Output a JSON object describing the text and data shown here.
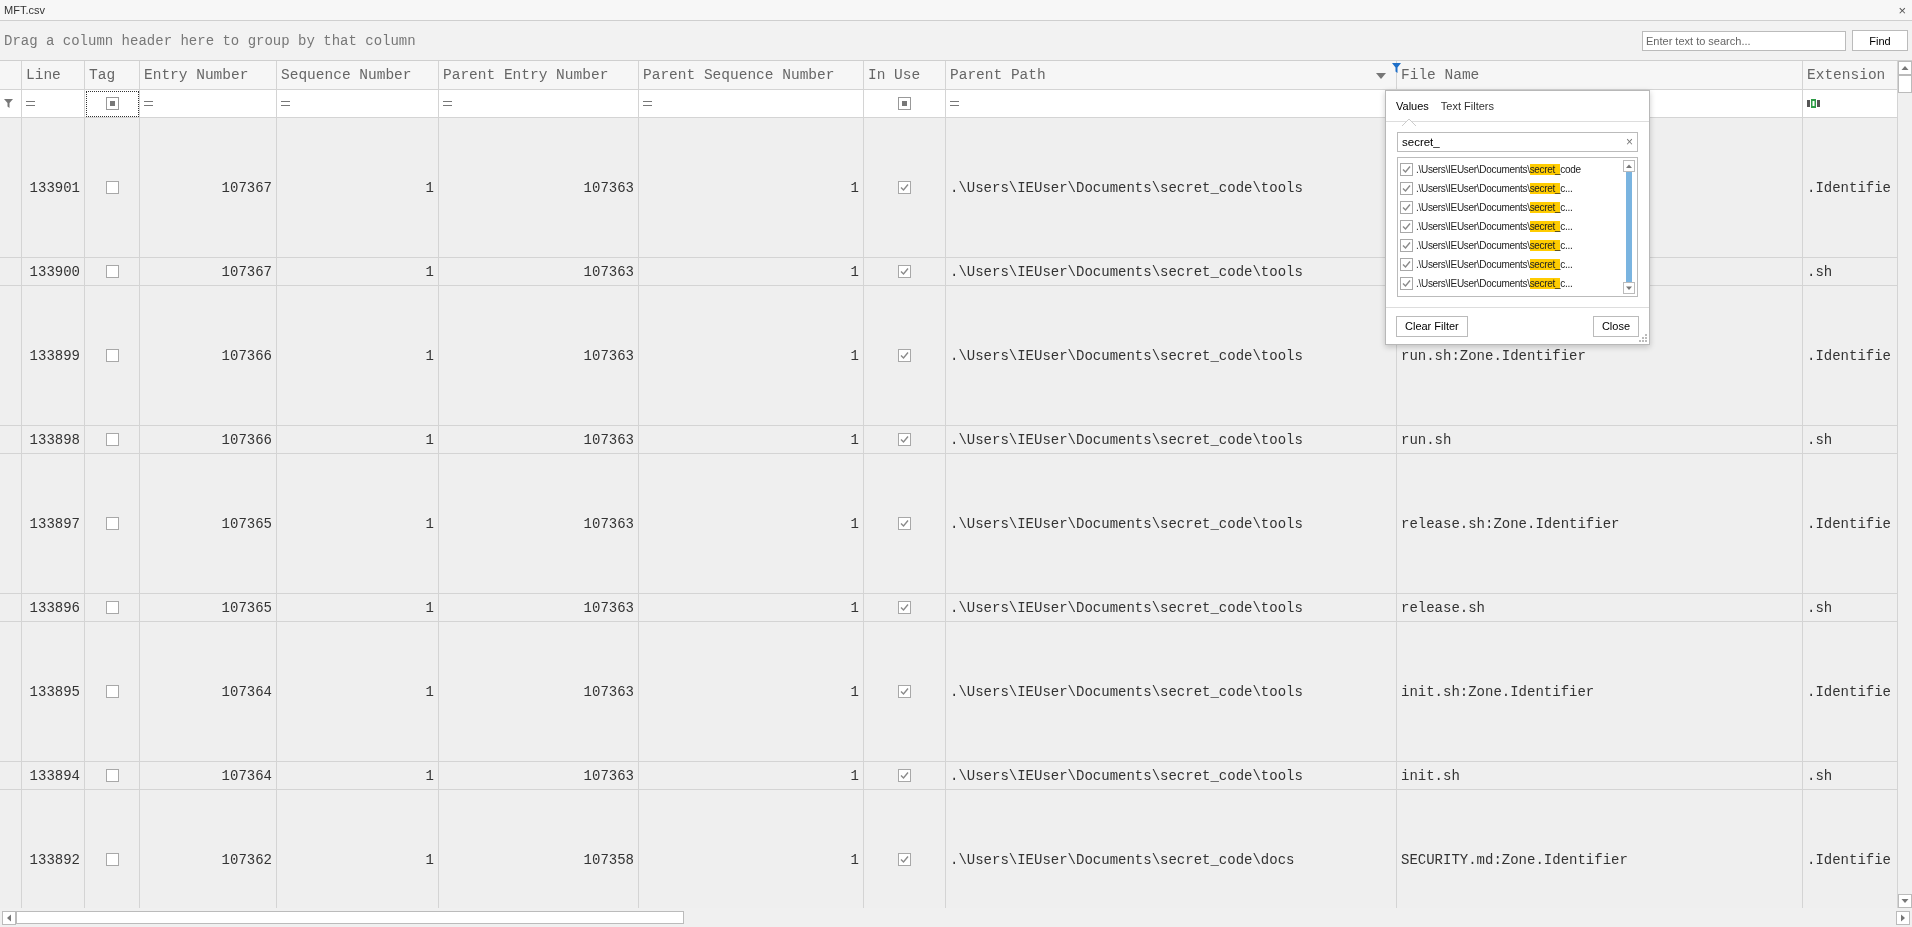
{
  "window": {
    "title": "MFT.csv",
    "close": "×"
  },
  "group_panel": {
    "hint": "Drag a column header here to group by that column"
  },
  "search": {
    "placeholder": "Enter text to search...",
    "button": "Find"
  },
  "columns": [
    {
      "label": "Line",
      "kind": "number",
      "filter": {
        "kind": "equals"
      }
    },
    {
      "label": "Tag",
      "kind": "check",
      "filter": {
        "kind": "checkbox",
        "indeterminate": true
      }
    },
    {
      "label": "Entry Number",
      "kind": "number",
      "filter": {
        "kind": "equals"
      }
    },
    {
      "label": "Sequence Number",
      "kind": "number",
      "filter": {
        "kind": "equals"
      }
    },
    {
      "label": "Parent Entry Number",
      "kind": "number",
      "filter": {
        "kind": "equals"
      }
    },
    {
      "label": "Parent Sequence Number",
      "kind": "number",
      "filter": {
        "kind": "equals"
      }
    },
    {
      "label": "In Use",
      "kind": "check",
      "filter": {
        "kind": "checkbox",
        "indeterminate": true
      }
    },
    {
      "label": "Parent Path",
      "kind": "text",
      "filter": {
        "kind": "equals"
      },
      "dropdown": true,
      "filtered": true
    },
    {
      "label": "File Name",
      "kind": "text"
    },
    {
      "label": "Extension",
      "kind": "text",
      "filter": {
        "kind": "contains"
      }
    }
  ],
  "rows": [
    {
      "kind": "tall",
      "cells": [
        "133901",
        {
          "checked": false
        },
        "107367",
        "1",
        "107363",
        "1",
        {
          "checked": true
        },
        ".\\Users\\IEUser\\Documents\\secret_code\\tools",
        null,
        ".Identifie"
      ]
    },
    {
      "kind": "short",
      "cells": [
        "133900",
        {
          "checked": false
        },
        "107367",
        "1",
        "107363",
        "1",
        {
          "checked": true
        },
        ".\\Users\\IEUser\\Documents\\secret_code\\tools",
        null,
        ".sh"
      ]
    },
    {
      "kind": "tall",
      "cells": [
        "133899",
        {
          "checked": false
        },
        "107366",
        "1",
        "107363",
        "1",
        {
          "checked": true
        },
        ".\\Users\\IEUser\\Documents\\secret_code\\tools",
        "run.sh:Zone.Identifier",
        ".Identifie"
      ]
    },
    {
      "kind": "short",
      "cells": [
        "133898",
        {
          "checked": false
        },
        "107366",
        "1",
        "107363",
        "1",
        {
          "checked": true
        },
        ".\\Users\\IEUser\\Documents\\secret_code\\tools",
        "run.sh",
        ".sh"
      ]
    },
    {
      "kind": "tall",
      "cells": [
        "133897",
        {
          "checked": false
        },
        "107365",
        "1",
        "107363",
        "1",
        {
          "checked": true
        },
        ".\\Users\\IEUser\\Documents\\secret_code\\tools",
        "release.sh:Zone.Identifier",
        ".Identifie"
      ]
    },
    {
      "kind": "short",
      "cells": [
        "133896",
        {
          "checked": false
        },
        "107365",
        "1",
        "107363",
        "1",
        {
          "checked": true
        },
        ".\\Users\\IEUser\\Documents\\secret_code\\tools",
        "release.sh",
        ".sh"
      ]
    },
    {
      "kind": "tall",
      "cells": [
        "133895",
        {
          "checked": false
        },
        "107364",
        "1",
        "107363",
        "1",
        {
          "checked": true
        },
        ".\\Users\\IEUser\\Documents\\secret_code\\tools",
        "init.sh:Zone.Identifier",
        ".Identifie"
      ]
    },
    {
      "kind": "short",
      "cells": [
        "133894",
        {
          "checked": false
        },
        "107364",
        "1",
        "107363",
        "1",
        {
          "checked": true
        },
        ".\\Users\\IEUser\\Documents\\secret_code\\tools",
        "init.sh",
        ".sh"
      ]
    },
    {
      "kind": "tall",
      "cells": [
        "133892",
        {
          "checked": false
        },
        "107362",
        "1",
        "107358",
        "1",
        {
          "checked": true
        },
        ".\\Users\\IEUser\\Documents\\secret_code\\docs",
        "SECURITY.md:Zone.Identifier",
        ".Identifie"
      ]
    }
  ],
  "filter_popup": {
    "tabs": [
      {
        "label": "Values",
        "selected": true
      },
      {
        "label": "Text Filters",
        "selected": false
      }
    ],
    "search_value": "secret_",
    "clear": "×",
    "items": [
      {
        "prefix": ".\\Users\\IEUser\\Documents\\",
        "match": "secret_",
        "rest": "code",
        "checked": true
      },
      {
        "prefix": ".\\Users\\IEUser\\Documents\\",
        "match": "secret_",
        "rest": "c...",
        "checked": true
      },
      {
        "prefix": ".\\Users\\IEUser\\Documents\\",
        "match": "secret_",
        "rest": "c...",
        "checked": true
      },
      {
        "prefix": ".\\Users\\IEUser\\Documents\\",
        "match": "secret_",
        "rest": "c...",
        "checked": true
      },
      {
        "prefix": ".\\Users\\IEUser\\Documents\\",
        "match": "secret_",
        "rest": "c...",
        "checked": true
      },
      {
        "prefix": ".\\Users\\IEUser\\Documents\\",
        "match": "secret_",
        "rest": "c...",
        "checked": true
      },
      {
        "prefix": ".\\Users\\IEUser\\Documents\\",
        "match": "secret_",
        "rest": "c...",
        "checked": true
      }
    ],
    "buttons": [
      "Clear Filter",
      "Close"
    ]
  }
}
